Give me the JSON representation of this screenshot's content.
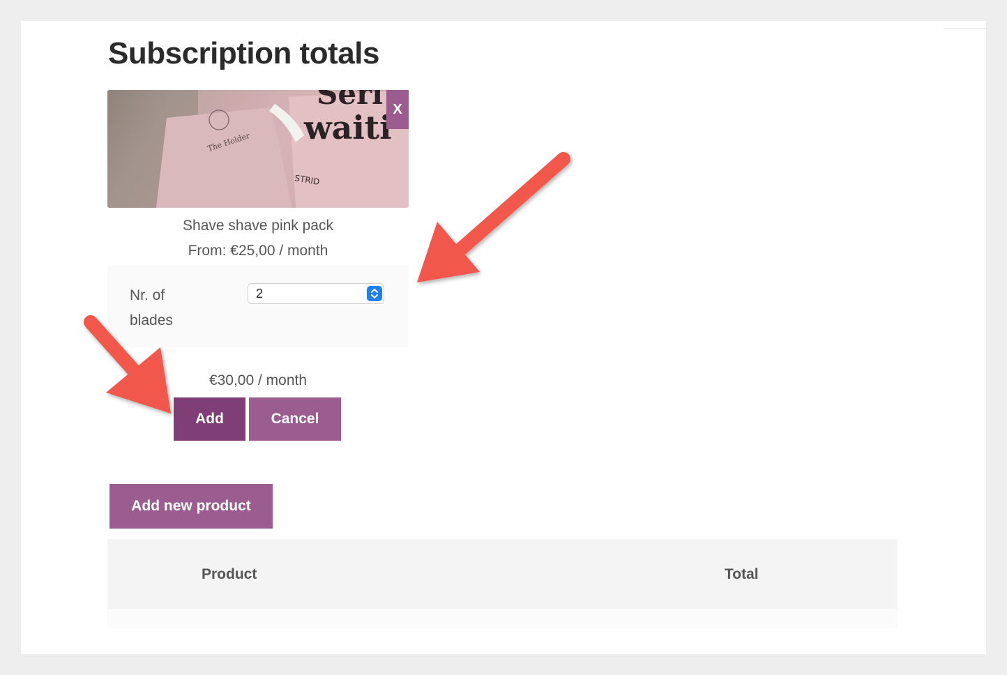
{
  "page": {
    "title": "Subscription totals"
  },
  "product": {
    "name": "Shave shave pink pack",
    "price_from": "From: €25,00 / month",
    "remove_label": "X",
    "image": "product-photo-pink-pack"
  },
  "attribute": {
    "label": "Nr. of blades",
    "selected_value": "2"
  },
  "subtotal": "€30,00 / month",
  "actions": {
    "add_label": "Add",
    "cancel_label": "Cancel",
    "add_new_label": "Add new product"
  },
  "table": {
    "headers": [
      "Product",
      "Total"
    ]
  },
  "colors": {
    "primary": "#9b5c8f",
    "primary_dark": "#7f3e75",
    "annotation_arrow": "#f1594b",
    "select_stepper": "#1f7ff2"
  }
}
